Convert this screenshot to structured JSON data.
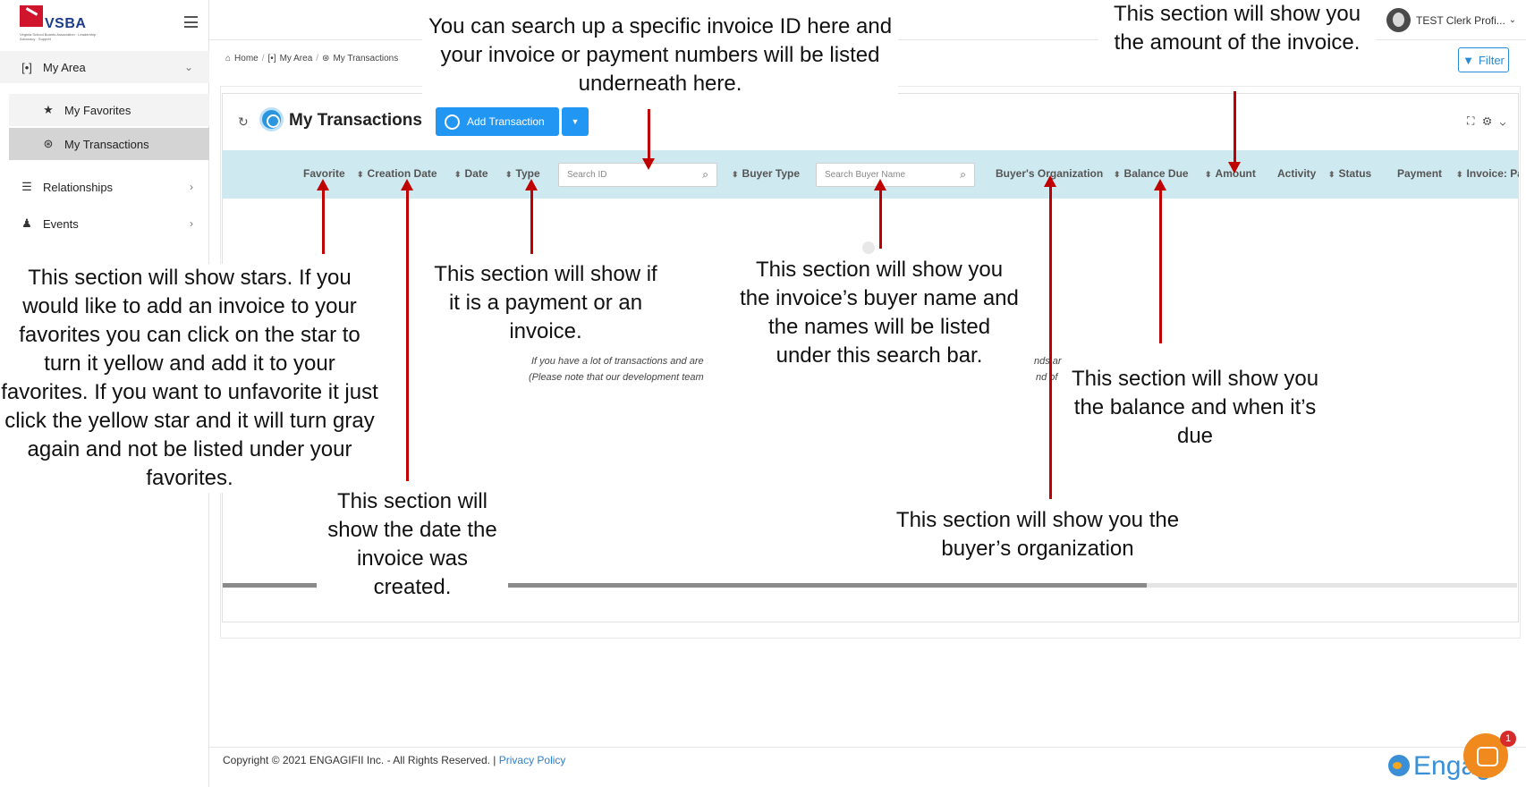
{
  "brand": {
    "name": "VSBA",
    "tagline": "Virginia School Boards Association · Leadership · Advocacy · Support"
  },
  "user": {
    "name": "TEST Clerk Profi...",
    "chevron": "⌄"
  },
  "sidebar": {
    "items": [
      {
        "label": "My Area",
        "icon": "user-focus-icon",
        "chevron": "⌄"
      },
      {
        "label": "My Favorites",
        "icon": "star-icon"
      },
      {
        "label": "My Transactions",
        "icon": "transactions-icon"
      },
      {
        "label": "Relationships",
        "icon": "server-icon",
        "chevron": "›"
      },
      {
        "label": "Events",
        "icon": "person-icon",
        "chevron": "›"
      }
    ]
  },
  "breadcrumb": {
    "home": "Home",
    "area": "My Area",
    "current": "My Transactions"
  },
  "filter": {
    "label": "Filter"
  },
  "page": {
    "title": "My Transactions",
    "add_label": "Add Transaction",
    "tools": "⛶ ⚙ ⌄"
  },
  "table": {
    "headers": {
      "favorite": "Favorite",
      "creation_date": "Creation Date",
      "date": "Date",
      "type": "Type",
      "search_id_placeholder": "Search ID",
      "buyer_type": "Buyer Type",
      "search_buyer_placeholder": "Search Buyer Name",
      "buyer_org": "Buyer's Organization",
      "balance_due": "Balance Due",
      "amount": "Amount",
      "activity": "Activity",
      "status": "Status",
      "payment": "Payment",
      "invoice": "Invoice: Pa"
    },
    "empty_line1": "If you have a lot of transactions and are",
    "empty_line2": "(Please note that our development team",
    "empty_frag1": "nds ar",
    "empty_frag2": "nd of"
  },
  "annotations": {
    "search_id": "You can search up a specific invoice ID here and your invoice or payment numbers will be listed underneath here.",
    "amount": "This section will show you the amount of the invoice.",
    "favorite": "This section will show stars. If you would like to add an invoice to your favorites you can click on the star to turn it yellow and add it to your favorites. If you want to unfavorite it just click the yellow star and it will turn gray again and not be listed under your favorites.",
    "type": "This section will show if it is a payment or an invoice.",
    "buyer_name": "This section will show you the invoice’s buyer name and the names will be listed under this search bar.",
    "balance": "This section will show you the balance and when it’s due",
    "creation_date": "This section will show the date the invoice was created.",
    "buyer_org": "This section will show you the buyer’s organization"
  },
  "footer": {
    "copyright": "Copyright © 2021 ENGAGIFII Inc. - All Rights Reserved. | ",
    "privacy": "Privacy Policy",
    "engage_logo": "Engag",
    "chat_badge": "1"
  },
  "colors": {
    "accent": "#2196f3",
    "header_bg": "#cfe9f0",
    "arrow": "#c00000",
    "brand_red": "#d0142c"
  }
}
